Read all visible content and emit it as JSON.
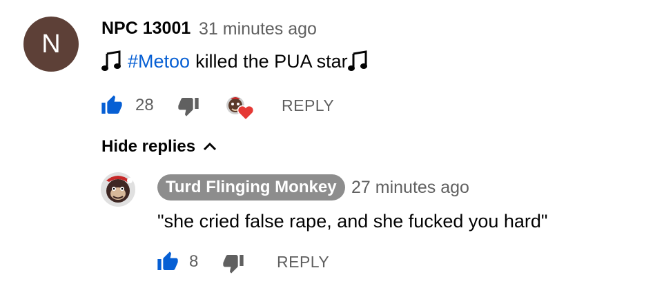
{
  "comment": {
    "avatar_letter": "N",
    "avatar_color": "#5d4037",
    "author": "NPC 13001",
    "timestamp": "31 minutes ago",
    "hashtag": "#Metoo",
    "text": " killed the PUA star",
    "like_count": "28",
    "reply_label": "REPLY",
    "hearted": true
  },
  "hide_replies_label": "Hide replies",
  "reply": {
    "author": "Turd Flinging Monkey",
    "timestamp": "27 minutes ago",
    "text": "\"she cried false rape, and she fucked you hard\"",
    "like_count": "8",
    "reply_label": "REPLY"
  },
  "colors": {
    "link_blue": "#065fd4",
    "like_blue": "#065fd4",
    "secondary_gray": "#606060",
    "badge_gray": "#8d8d8d",
    "heart_red": "#e53935"
  },
  "icons": {
    "note": "music-note-icon",
    "like": "thumbs-up-icon",
    "dislike": "thumbs-down-icon",
    "heart": "creator-heart-icon",
    "chevron": "chevron-up-icon"
  }
}
